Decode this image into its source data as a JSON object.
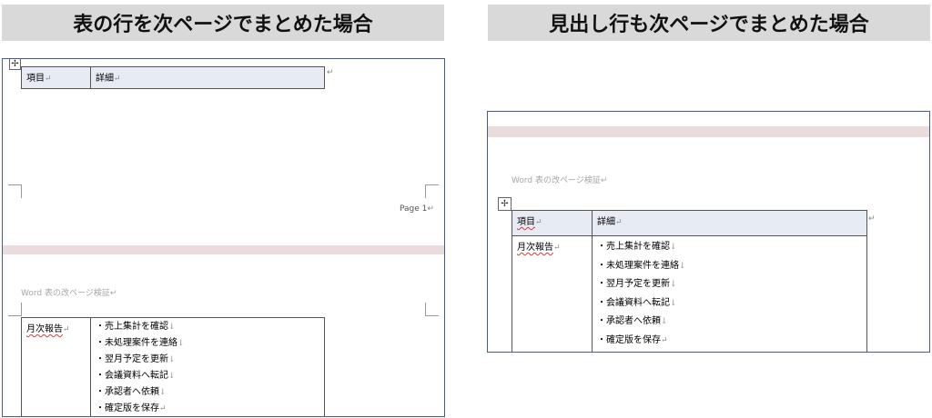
{
  "left": {
    "banner": "表の行を次ページでまとめた場合",
    "table_header": {
      "col1": "項目",
      "col2": "詳細"
    },
    "page_footer": "Page 1",
    "doc_title": "Word 表の改ページ検証",
    "row": {
      "label": "月次報告",
      "items": [
        "・売上集計を確認",
        "・未処理案件を連絡",
        "・翌月予定を更新",
        "・会議資料へ転記",
        "・承認者へ依頼",
        "・確定版を保存"
      ]
    }
  },
  "right": {
    "banner": "見出し行も次ページでまとめた場合",
    "doc_title": "Word 表の改ページ検証",
    "table_header": {
      "col1": "項目",
      "col2": "詳細"
    },
    "row": {
      "label": "月次報告",
      "items": [
        "・売上集計を確認",
        "・未処理案件を連絡",
        "・翌月予定を更新",
        "・会議資料へ転記",
        "・承認者へ依頼",
        "・確定版を保存"
      ]
    }
  },
  "marks": {
    "para": "↵",
    "line": "↓"
  },
  "colors": {
    "banner_bg": "#d9d9d9",
    "header_fill": "#e7ebf3",
    "page_gap": "#eadcdc",
    "panel_border": "#4a5a8a"
  },
  "icons": {
    "table_move_handle": "table-move-handle-icon"
  }
}
